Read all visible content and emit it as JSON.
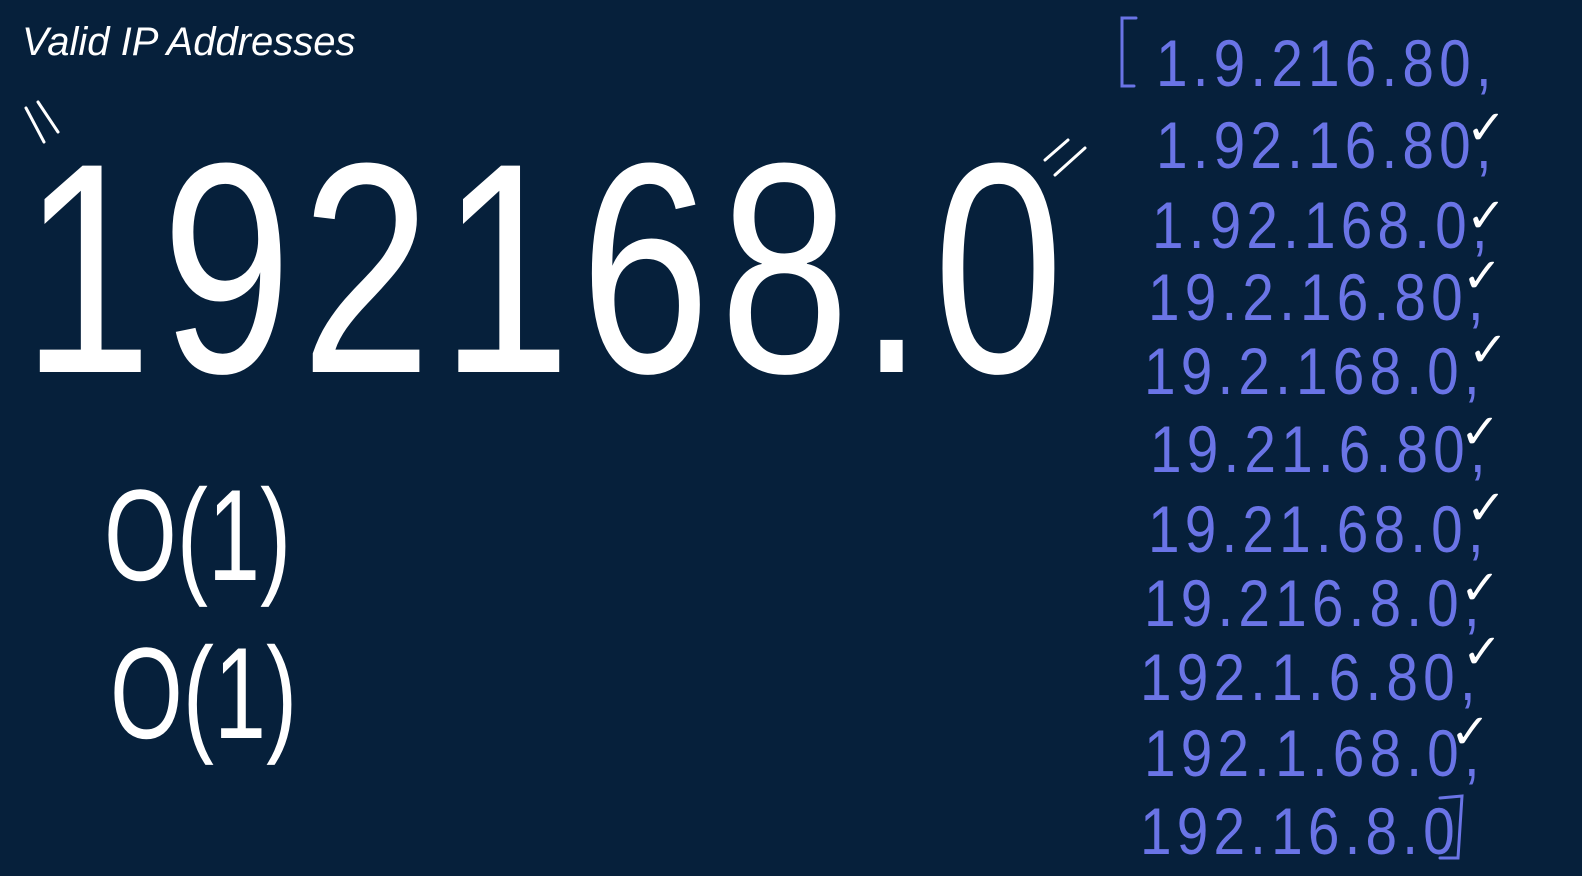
{
  "title": "Valid IP Addresses",
  "input_string": "\"192168.0\"",
  "input_display": "192168.0",
  "complexity": {
    "time": "O(1)",
    "space": "O(1)"
  },
  "results": {
    "open_bracket": "[",
    "close_bracket": "]",
    "items": [
      {
        "text": "1.9.216.80,",
        "checked": false
      },
      {
        "text": "1.92.16.80,",
        "checked": true
      },
      {
        "text": "1.92.168.0,",
        "checked": true
      },
      {
        "text": "19.2.16.80,",
        "checked": true
      },
      {
        "text": "19.2.168.0,",
        "checked": true
      },
      {
        "text": "19.21.6.80,",
        "checked": true
      },
      {
        "text": "19.21.68.0,",
        "checked": true
      },
      {
        "text": "19.216.8.0,",
        "checked": true
      },
      {
        "text": "192.1.6.80,",
        "checked": true
      },
      {
        "text": "192.1.68.0,",
        "checked": true
      },
      {
        "text": "192.16.8.0",
        "checked": true
      }
    ]
  },
  "colors": {
    "background": "#06203b",
    "ink_white": "#ffffff",
    "ink_blue": "#6a74e6"
  }
}
